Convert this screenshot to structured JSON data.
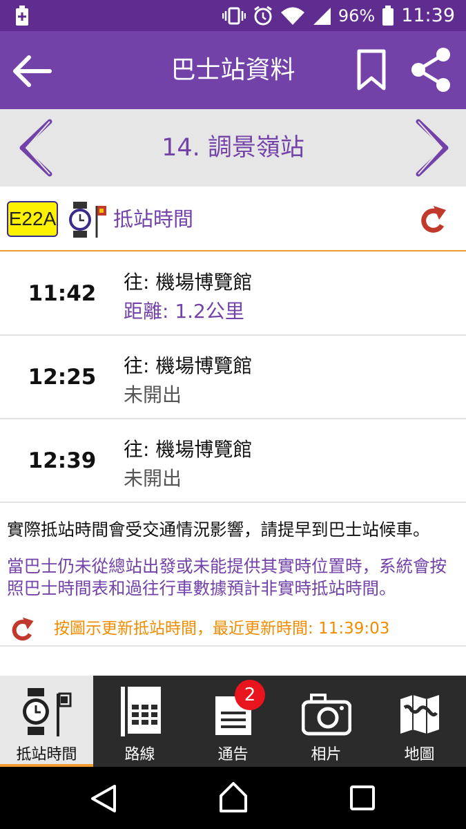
{
  "status_bar": {
    "battery_percent": "96%",
    "time": "11:39"
  },
  "app_bar": {
    "title": "巴士站資料"
  },
  "station": {
    "name": "14. 調景嶺站"
  },
  "route": {
    "number": "E22A",
    "eta_label": "抵站時間"
  },
  "etas": [
    {
      "time": "11:42",
      "destination": "往: 機場博覽館",
      "status": "距離: 1.2公里"
    },
    {
      "time": "12:25",
      "destination": "往: 機場博覽館",
      "status": "未開出"
    },
    {
      "time": "12:39",
      "destination": "往: 機場博覽館",
      "status": "未開出"
    }
  ],
  "notes": {
    "traffic_note": "實際抵站時間會受交通情況影響，請提早到巴士站候車。",
    "schedule_note": "當巴士仍未從總站出發或未能提供其實時位置時，系統會按照巴士時間表和過往行車數據預計非實時抵站時間。",
    "refresh_note": "按圖示更新抵站時間，最近更新時間: 11:39:03"
  },
  "tabs": [
    {
      "label": "抵站時間",
      "icon": "watch-flag-icon",
      "active": true
    },
    {
      "label": "路線",
      "icon": "route-table-icon"
    },
    {
      "label": "通告",
      "icon": "notice-document-icon"
    },
    {
      "label": "相片",
      "icon": "camera-icon"
    },
    {
      "label": "地圖",
      "icon": "map-icon"
    }
  ],
  "notice_badge": "2",
  "colors": {
    "primary": "#7342a8",
    "status_bar": "#5e2d8f",
    "accent_orange": "#f29a2e",
    "route_badge": "#fff200",
    "refresh_red": "#c0392b",
    "badge_red": "#e8141e"
  }
}
